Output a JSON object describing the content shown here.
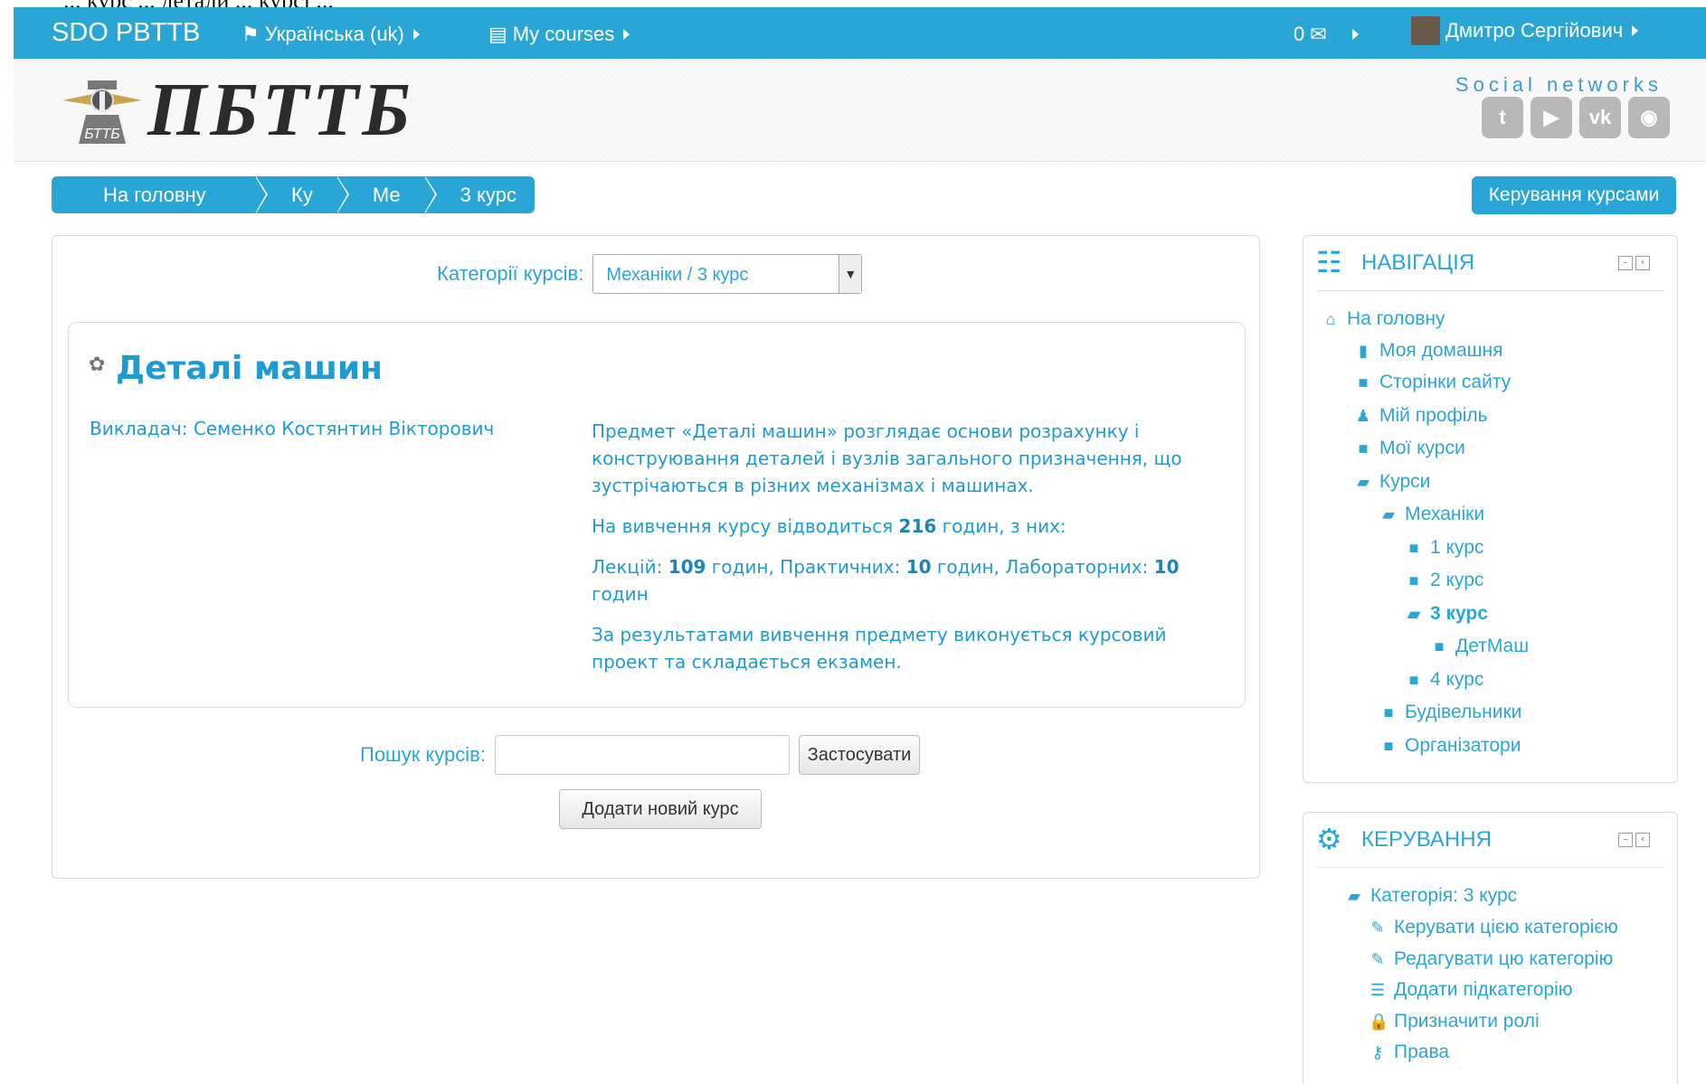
{
  "top_strip_text": "... курс ... детали ... курсі ...",
  "navbar": {
    "brand": "SDO PBTTB",
    "language": "Українська (uk)",
    "my_courses": "My courses",
    "messages_count": "0",
    "user_name": "Дмитро Сергійович"
  },
  "header": {
    "logo_text": "ПБТТБ",
    "logo_emblem_text": "БТТБ",
    "social_label": "Social networks",
    "social": [
      "twitter-icon",
      "youtube-icon",
      "vk-icon",
      "globe-icon"
    ]
  },
  "breadcrumb": [
    "На головну",
    "Ку",
    "Ме",
    "3 курс"
  ],
  "manage_courses_label": "Керування курсами",
  "category": {
    "label": "Категорії курсів:",
    "selected": "Механіки / 3 курс"
  },
  "course": {
    "title": "Деталі машин",
    "teacher": "Викладач: Семенко Костянтин Вікторович",
    "desc1": "Предмет «Деталі машин» розглядає основи розрахунку і конструювання деталей і вузлів загального призначення, що зустрічаються в різних механізмах і машинах.",
    "desc2_pre": "На вивчення курсу відводиться ",
    "desc2_hours": "216",
    "desc2_post": " годин, з них:",
    "lec_label": "Лекцій: ",
    "lec_val": "109",
    "prac_label": " годин, Практичних: ",
    "prac_val": "10",
    "lab_label": " годин, Лабораторних: ",
    "lab_val": "10",
    "lab_post": " годин",
    "desc4": "За результатами вивчення предмету виконується курсовий проект та складається екзамен."
  },
  "search": {
    "label": "Пошук курсів:",
    "value": "",
    "apply": "Застосувати",
    "add_course": "Додати новий курс"
  },
  "navigation": {
    "title": "НАВІГАЦІЯ",
    "items": [
      "На головну",
      "Моя домашня",
      "Сторінки сайту",
      "Мій профіль",
      "Мої курси",
      "Курси",
      "Механіки",
      "1 курс",
      "2 курс",
      "3 курс",
      "ДетМаш",
      "4 курс",
      "Будівельники",
      "Організатори"
    ]
  },
  "admin": {
    "title": "КЕРУВАННЯ",
    "items": [
      "Категорія: 3 курс",
      "Керувати цією категорією",
      "Редагувати цю категорію",
      "Додати підкатегорію",
      "Призначити ролі",
      "Права"
    ]
  }
}
